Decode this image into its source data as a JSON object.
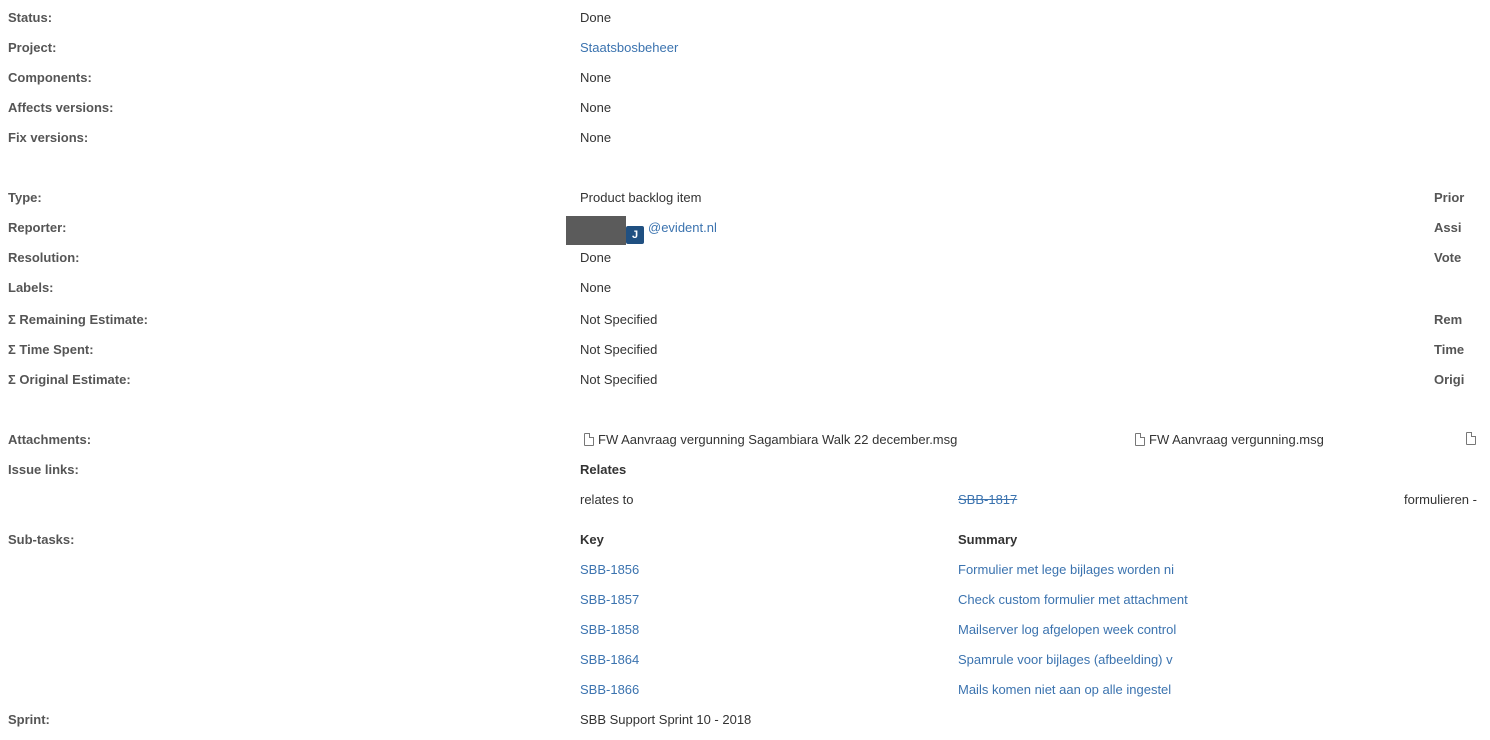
{
  "fields": {
    "status": {
      "label": "Status:",
      "value": "Done"
    },
    "project": {
      "label": "Project:",
      "value": "Staatsbosbeheer"
    },
    "components": {
      "label": "Components:",
      "value": "None"
    },
    "affects_versions": {
      "label": "Affects versions:",
      "value": "None"
    },
    "fix_versions": {
      "label": "Fix versions:",
      "value": "None"
    },
    "type": {
      "label": "Type:",
      "value": "Product backlog item"
    },
    "reporter": {
      "label": "Reporter:",
      "value": "@evident.nl",
      "avatar_initial": "J"
    },
    "resolution": {
      "label": "Resolution:",
      "value": "Done"
    },
    "labels": {
      "label": "Labels:",
      "value": "None"
    },
    "remaining_estimate": {
      "label": "Σ Remaining Estimate:",
      "value": "Not Specified"
    },
    "time_spent": {
      "label": "Σ Time Spent:",
      "value": "Not Specified"
    },
    "original_estimate": {
      "label": "Σ Original Estimate:",
      "value": "Not Specified"
    },
    "attachments": {
      "label": "Attachments:"
    },
    "issue_links": {
      "label": "Issue links:"
    },
    "subtasks": {
      "label": "Sub-tasks:"
    },
    "sprint": {
      "label": "Sprint:",
      "value": "SBB Support Sprint 10 - 2018"
    }
  },
  "right_column": {
    "priority": "Prior",
    "assignee": "Assi",
    "votes": "Vote",
    "remaining": "Rem",
    "time": "Time",
    "original": "Origi"
  },
  "attachments": [
    {
      "name": "FW Aanvraag vergunning Sagambiara Walk 22 december.msg"
    },
    {
      "name": "FW Aanvraag vergunning.msg"
    }
  ],
  "issue_links": {
    "header": "Relates",
    "row": {
      "relation": "relates to",
      "key": "SBB-1817",
      "summary": "formulieren -"
    }
  },
  "subtasks": {
    "headers": {
      "key": "Key",
      "summary": "Summary"
    },
    "rows": [
      {
        "key": "SBB-1856",
        "summary": "Formulier met lege bijlages worden ni"
      },
      {
        "key": "SBB-1857",
        "summary": "Check custom formulier met attachment"
      },
      {
        "key": "SBB-1858",
        "summary": "Mailserver log afgelopen week control"
      },
      {
        "key": "SBB-1864",
        "summary": "Spamrule voor bijlages (afbeelding) v"
      },
      {
        "key": "SBB-1866",
        "summary": "Mails komen niet aan op alle ingestel"
      }
    ]
  },
  "colors": {
    "link": "#3b73af",
    "avatar_badge": "#205081",
    "label": "#555555"
  }
}
